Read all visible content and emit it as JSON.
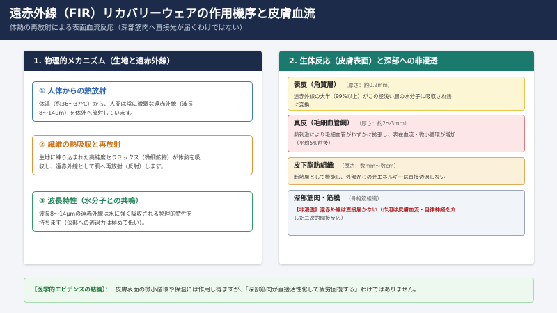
{
  "header": {
    "title": "遠赤外線（FIR）リカバリーウェアの作用機序と皮膚血流",
    "subtitle": "体熱の再放射による表面血流反応（深部筋肉へ直接光が届くわけではない）"
  },
  "left_panel": {
    "title": "1. 物理的メカニズム（生地と遠赤外線）",
    "cards": [
      {
        "title": "① 人体からの熱放射",
        "lines": [
          "体温（約36〜37℃）から、人間は常に微弱な遠赤外線（波長",
          "8〜14μm）を体外へ放射しています。"
        ]
      },
      {
        "title": "② 繊維の熱吸収と再放射",
        "lines": [
          "生地に練り込まれた高純度セラミックス（微細鉱物）が体熱を吸",
          "収し、遠赤外線として肌へ再放射（反射）します。"
        ]
      },
      {
        "title": "③ 波長特性（水分子との共鳴）",
        "lines": [
          "波長8〜14μmの遠赤外線は水に強く吸収される物理的特性を",
          "持ちます（深部への透過力は極めて低い）。"
        ]
      }
    ]
  },
  "right_panel": {
    "title": "2. 生体反応（皮膚表面）と深部への非浸透",
    "layers": [
      {
        "name": "表皮（角質層）",
        "thickness": "（厚さ：約0.2mm）",
        "lines": [
          "遠赤外線の大半（99%以上）がこの極浅い層の水分子に吸収され熱",
          "に変換"
        ]
      },
      {
        "name": "真皮（毛細血管網）",
        "thickness": "（厚さ：約2〜3mm）",
        "lines": [
          "熱刺激により毛細血管がわずかに拡張し、表在血流・微小循環が増加",
          "（平均5%前後）"
        ]
      },
      {
        "name": "皮下脂肪組織",
        "thickness": "（厚さ：数mm〜数cm）",
        "lines": [
          "断熱層として機能し、外部からの光エネルギーは直接透過しない"
        ]
      },
      {
        "name": "深部筋肉・筋膜",
        "thickness": "（骨格筋組織）",
        "warning": "【非浸透】遠赤外線は直接届かない（作用は皮膚血流・自律神経を介",
        "warning_cont": "した二次的間接反応）"
      }
    ]
  },
  "footer": {
    "label": "【医学的エビデンスの結論】：",
    "text": "皮膚表面の微小循環や保温には作用し得ますが、「深部筋肉が直接活性化して疲労回復する」わけではありません。"
  }
}
